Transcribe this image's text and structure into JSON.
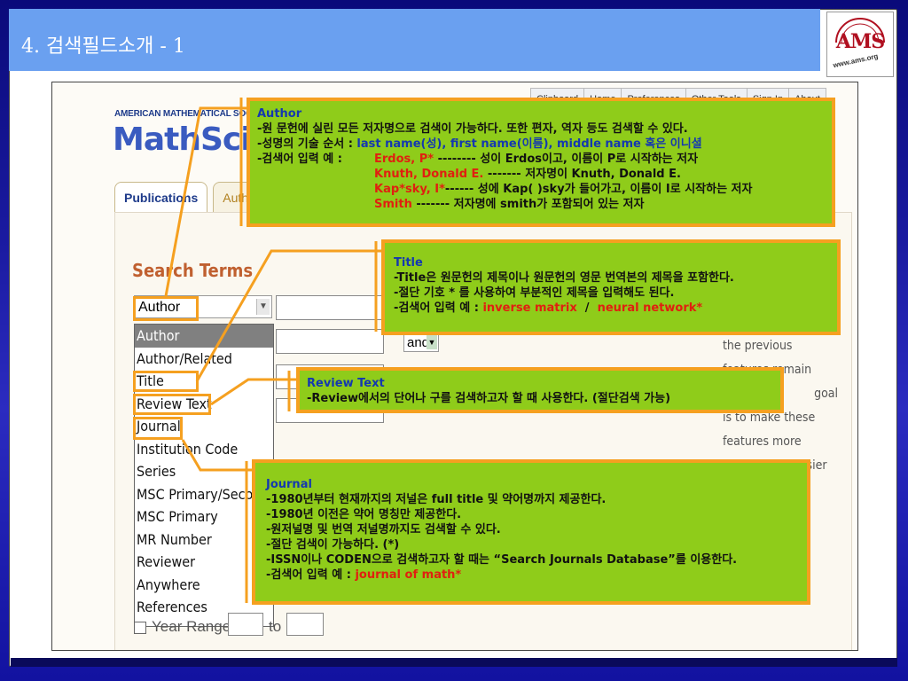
{
  "slide": {
    "title": "4. 검색필드소개 - 1",
    "logo_text": "AMS",
    "logo_url": "www.ams.org"
  },
  "mathscinet": {
    "top_nav": [
      "Clipboard",
      "Home",
      "Preferences",
      "Other Tools",
      "Sign In",
      "About"
    ],
    "publisher": "AMERICAN MATHEMATICAL SOCIETY",
    "logo": "MathSciNet",
    "tabs": [
      "Publications",
      "Authors"
    ],
    "search_terms_label": "Search Terms",
    "selected_field": "Author",
    "field_options": [
      "Author",
      "Author/Related",
      "Title",
      "Review Text",
      "Journal",
      "Institution Code",
      "Series",
      "MSC Primary/Secondary",
      "MSC Primary",
      "MR Number",
      "Reviewer",
      "Anywhere",
      "References"
    ],
    "operator": "and",
    "year_range_label": "Year Range:",
    "year_to_label": "to",
    "side_note": [
      "the previous",
      "features remain",
      "goal",
      "is to make these",
      "features more",
      "evident and easier"
    ]
  },
  "callouts": {
    "author": {
      "heading": "Author",
      "line1": "-원 문헌에 실린 모든 저자명으로 검색이 가능하다. 또한 편자, 역자 등도 검색할 수 있다.",
      "line2_a": "-성명의 기술 순서 : ",
      "line2_b": "last name(성), first name(이름), middle name 혹은 이니셜",
      "line3_label": "-검색어 입력 예 :",
      "examples": [
        {
          "term": "Erdos, P*",
          "desc": " -------- 성이 Erdos이고, 이름이 P로 시작하는 저자"
        },
        {
          "term": "Knuth, Donald E.",
          "desc": " ------- 저자명이 Knuth, Donald E."
        },
        {
          "term": "Kap*sky, I*",
          "desc": "------ 성에 Kap( )sky가 들어가고, 이름이 I로 시작하는 저자"
        },
        {
          "term": "Smith",
          "desc": " ------- 저자명에 smith가 포함되어 있는 저자"
        }
      ]
    },
    "title": {
      "heading": "Title",
      "line1": "-Title은 원문헌의 제목이나 원문헌의 영문 번역본의 제목을 포함한다.",
      "line2": "-절단 기호 * 를 사용하여 부분적인 제목을 입력해도 된다.",
      "line3_label": "-검색어 입력 예 : ",
      "ex1": "inverse matrix",
      "sep": "  /  ",
      "ex2": "neural network*"
    },
    "review": {
      "heading": "Review Text",
      "line1": "-Review에서의 단어나 구를 검색하고자 할 때 사용한다. (절단검색 가능)"
    },
    "journal": {
      "heading": "Journal",
      "line1": "-1980년부터 현재까지의 저널은 full title 및 약어명까지 제공한다.",
      "line2": "-1980년 이전은 약어 명칭만 제공한다.",
      "line3": "-원저널명 및 번역 저널명까지도 검색할 수 있다.",
      "line4": "-절단 검색이 가능하다. (*)",
      "line5": "-ISSN이나 CODEN으로 검색하고자 할 때는 “Search Journals Database”를 이용한다.",
      "line6_label": "-검색어 입력 예 : ",
      "ex": "journal of math*"
    }
  },
  "colors": {
    "callout_bg": "#8fcc1a",
    "callout_border": "#f5a020",
    "heading_blue": "#1438b0",
    "example_red": "#e02010"
  }
}
